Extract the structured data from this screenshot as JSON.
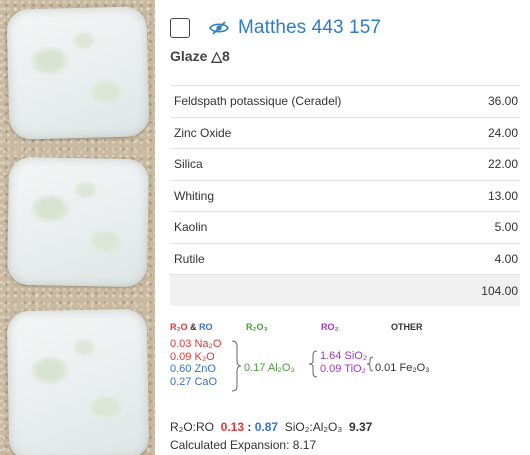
{
  "recipe": {
    "title": "Matthes 443 157",
    "cone_label": "Glaze △8",
    "ingredients": [
      {
        "name": "Feldspath potassique (Ceradel)",
        "amount": "36.00"
      },
      {
        "name": "Zinc Oxide",
        "amount": "24.00"
      },
      {
        "name": "Silica",
        "amount": "22.00"
      },
      {
        "name": "Whiting",
        "amount": "13.00"
      },
      {
        "name": "Kaolin",
        "amount": "5.00"
      },
      {
        "name": "Rutile",
        "amount": "4.00"
      }
    ],
    "total": "104.00"
  },
  "umf": {
    "headers": {
      "r2o_ro_part1": "R₂O",
      "amp": " & ",
      "r2o_ro_part2": "RO",
      "r2o3": "R₂O₃",
      "ro2": "RO₂",
      "other": "OTHER"
    },
    "fluxes": [
      {
        "amount": "0.03",
        "oxide": "Na₂O",
        "group": "r2o"
      },
      {
        "amount": "0.09",
        "oxide": "K₂O",
        "group": "r2o"
      },
      {
        "amount": "0.60",
        "oxide": "ZnO",
        "group": "ro"
      },
      {
        "amount": "0.27",
        "oxide": "CaO",
        "group": "ro"
      }
    ],
    "stabilizer": {
      "amount": "0.17",
      "oxide": "Al₂O₃"
    },
    "glass_formers": [
      {
        "amount": "1.64",
        "oxide": "SiO₂"
      },
      {
        "amount": "0.09",
        "oxide": "TiO₂"
      }
    ],
    "other": {
      "amount": "0.01",
      "oxide": "Fe₂O₃"
    }
  },
  "ratios": {
    "r2o_ro_label": "R₂O:RO",
    "r2o_value": "0.13",
    "colon": " : ",
    "ro_value": "0.87",
    "si_al_label": "SiO₂:Al₂O₃",
    "si_al_value": "9.37",
    "expansion_label": "Calculated Expansion:",
    "expansion_value": "8.17"
  },
  "colors": {
    "title": "#2f7dc1",
    "r2o": "#d63a3a",
    "ro": "#3673c9",
    "r2o3": "#4a9a3e",
    "ro2": "#9b3bbb"
  },
  "icons": {
    "visibility": "eye-slash-icon",
    "select": "checkbox"
  }
}
